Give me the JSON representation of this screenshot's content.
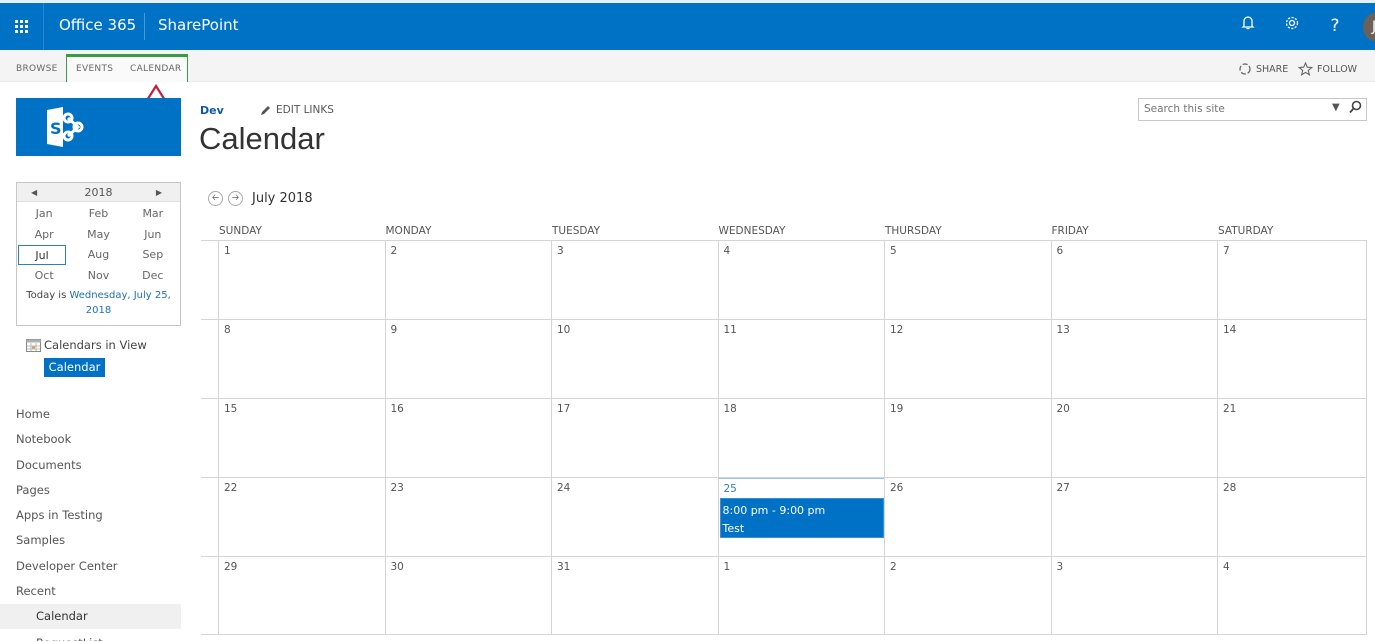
{
  "suite_bar": {
    "brand": "Office 365",
    "app": "SharePoint",
    "icons": [
      "bell-icon",
      "gear-icon",
      "help-icon"
    ],
    "help_glyph": "?",
    "avatar_initial": "J"
  },
  "ribbon": {
    "tabs": [
      "BROWSE",
      "EVENTS",
      "CALENDAR"
    ],
    "share_label": "SHARE",
    "follow_label": "FOLLOW"
  },
  "header": {
    "breadcrumb": "Dev",
    "edit_links": "EDIT LINKS",
    "title": "Calendar",
    "search_placeholder": "Search this site"
  },
  "mini_calendar": {
    "year": "2018",
    "months": [
      "Jan",
      "Feb",
      "Mar",
      "Apr",
      "May",
      "Jun",
      "Jul",
      "Aug",
      "Sep",
      "Oct",
      "Nov",
      "Dec"
    ],
    "selected_month": "Jul",
    "today_prefix": "Today is",
    "today_link": "Wednesday, July 25, 2018"
  },
  "calendars_in_view": {
    "label": "Calendars in View",
    "items": [
      "Calendar"
    ]
  },
  "quick_launch": {
    "items": [
      "Home",
      "Notebook",
      "Documents",
      "Pages",
      "Apps in Testing",
      "Samples",
      "Developer Center",
      "Recent"
    ],
    "recent_items": [
      "Calendar",
      "RequestList"
    ]
  },
  "calendar": {
    "month_label": "July 2018",
    "days_of_week": [
      "SUNDAY",
      "MONDAY",
      "TUESDAY",
      "WEDNESDAY",
      "THURSDAY",
      "FRIDAY",
      "SATURDAY"
    ],
    "weeks": [
      [
        "1",
        "2",
        "3",
        "4",
        "5",
        "6",
        "7"
      ],
      [
        "8",
        "9",
        "10",
        "11",
        "12",
        "13",
        "14"
      ],
      [
        "15",
        "16",
        "17",
        "18",
        "19",
        "20",
        "21"
      ],
      [
        "22",
        "23",
        "24",
        "25",
        "26",
        "27",
        "28"
      ],
      [
        "29",
        "30",
        "31",
        "1",
        "2",
        "3",
        "4"
      ]
    ],
    "today": "25",
    "events": [
      {
        "day": "25",
        "time": "8:00 pm - 9:00 pm",
        "title": "Test"
      }
    ]
  }
}
